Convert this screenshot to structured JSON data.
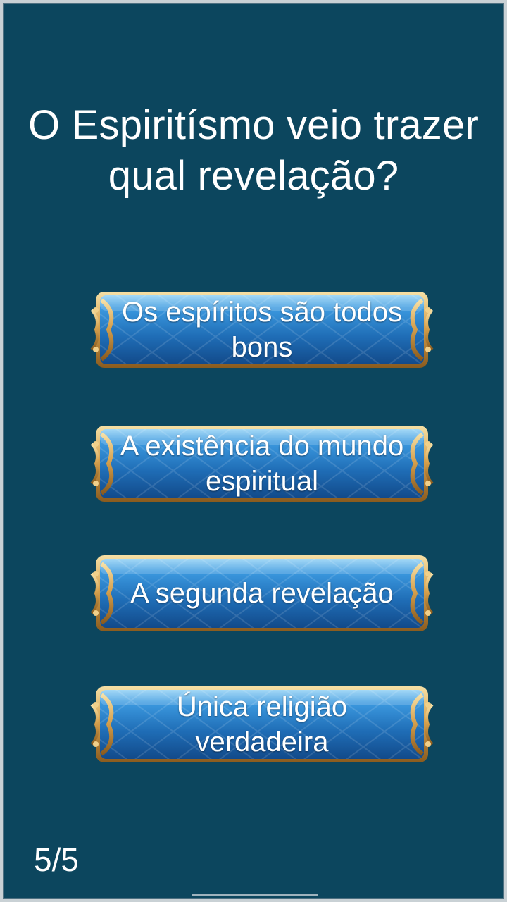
{
  "quiz": {
    "question": "O Espiritísmo veio trazer qual revelação?",
    "answers": [
      {
        "label": "Os espíritos são todos bons"
      },
      {
        "label": "A existência do mundo espiritual"
      },
      {
        "label": "A segunda revelação"
      },
      {
        "label": "Única religião verdadeira"
      }
    ],
    "progress": "5/5"
  },
  "colors": {
    "background": "#0c465e",
    "button_fill": "#2a7fc6",
    "button_border": "#d8a75a",
    "text": "#ffffff"
  }
}
